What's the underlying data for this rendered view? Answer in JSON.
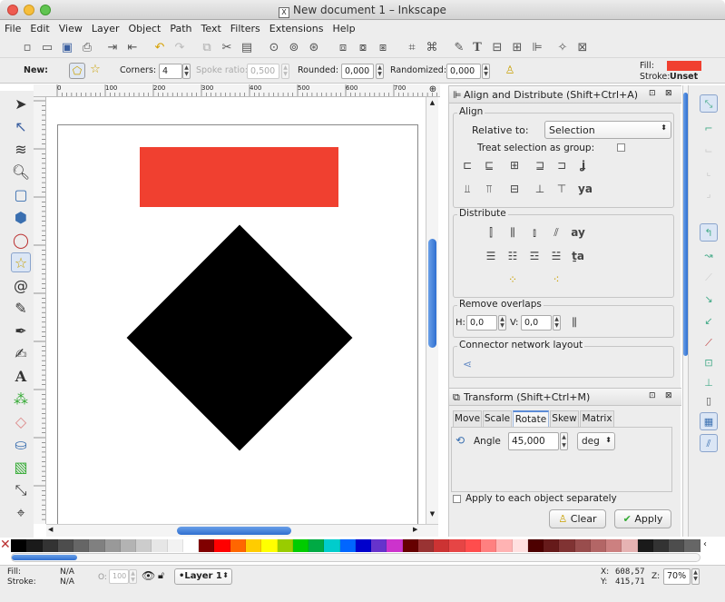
{
  "window": {
    "title": "New document 1 – Inkscape"
  },
  "menu": [
    "File",
    "Edit",
    "View",
    "Layer",
    "Object",
    "Path",
    "Text",
    "Filters",
    "Extensions",
    "Help"
  ],
  "controls": {
    "new_label": "New:",
    "corners_label": "Corners:",
    "corners_value": "4",
    "spoke_label": "Spoke ratio:",
    "spoke_value": "0,500",
    "rounded_label": "Rounded:",
    "rounded_value": "0,000",
    "randomized_label": "Randomized:",
    "randomized_value": "0,000",
    "fill_label": "Fill:",
    "stroke_label": "Stroke:",
    "stroke_value": "Unset",
    "fill_color": "#f04030"
  },
  "ruler": {
    "marks": [
      "0",
      "100",
      "200",
      "300",
      "400",
      "500",
      "600",
      "700"
    ]
  },
  "canvas": {
    "rect_color": "#f04030",
    "diamond_color": "#000000",
    "diamond_rotation_deg": 45
  },
  "align_panel": {
    "title": "Align and Distribute (Shift+Ctrl+A)",
    "align_section": "Align",
    "relative_label": "Relative to:",
    "relative_value": "Selection",
    "group_label": "Treat selection as group:",
    "distribute_section": "Distribute",
    "overlaps_section": "Remove overlaps",
    "h_label": "H:",
    "h_value": "0,0",
    "v_label": "V:",
    "v_value": "0,0",
    "connector_section": "Connector network layout"
  },
  "transform_panel": {
    "title": "Transform (Shift+Ctrl+M)",
    "tabs": [
      "Move",
      "Scale",
      "Rotate",
      "Skew",
      "Matrix"
    ],
    "active_tab": "Rotate",
    "angle_label": "Angle",
    "angle_value": "45,000",
    "unit": "deg",
    "apply_each_label": "Apply to each object separately",
    "clear_label": "Clear",
    "apply_label": "Apply"
  },
  "status": {
    "fill_label": "Fill:",
    "fill_value": "N/A",
    "stroke_label": "Stroke:",
    "stroke_value": "N/A",
    "opacity_label": "O:",
    "opacity_value": "100",
    "layer_value": "•Layer 1",
    "x_label": "X:",
    "x_value": "608,57",
    "y_label": "Y:",
    "y_value": "415,71",
    "zoom_label": "Z:",
    "zoom_value": "70%"
  },
  "palette": [
    "#000000",
    "#1a1a1a",
    "#333333",
    "#4d4d4d",
    "#666666",
    "#808080",
    "#999999",
    "#b3b3b3",
    "#cccccc",
    "#e6e6e6",
    "#f2f2f2",
    "#ffffff",
    "#800000",
    "#ff0000",
    "#ff6600",
    "#ffcc00",
    "#ffff00",
    "#99cc00",
    "#00cc00",
    "#00aa44",
    "#00cccc",
    "#0066ff",
    "#0000cc",
    "#6633cc",
    "#cc33cc",
    "#660000",
    "#993333",
    "#cc3333",
    "#e64545",
    "#ff4d4d",
    "#ff8080",
    "#ffb3b3",
    "#ffe0e0",
    "#4d0000",
    "#661a1a",
    "#803333",
    "#994d4d",
    "#b36666",
    "#cc8080",
    "#e6b3b3",
    "#1a1a1a",
    "#333333",
    "#4d4d4d",
    "#666666"
  ]
}
